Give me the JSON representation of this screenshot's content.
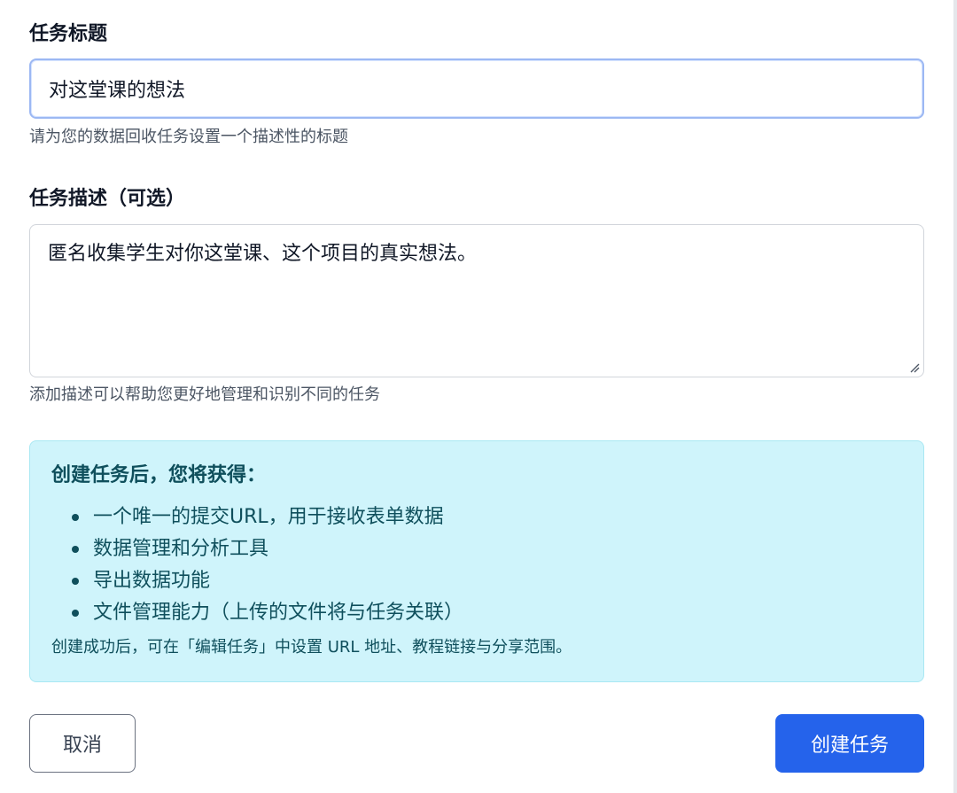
{
  "form": {
    "title_label": "任务标题",
    "title_value": "对这堂课的想法",
    "title_help": "请为您的数据回收任务设置一个描述性的标题",
    "description_label": "任务描述（可选）",
    "description_value": "匿名收集学生对你这堂课、这个项目的真实想法。",
    "description_help": "添加描述可以帮助您更好地管理和识别不同的任务"
  },
  "info": {
    "heading": "创建任务后，您将获得：",
    "items": [
      "一个唯一的提交URL，用于接收表单数据",
      "数据管理和分析工具",
      "导出数据功能",
      "文件管理能力（上传的文件将与任务关联）"
    ],
    "note": "创建成功后，可在「编辑任务」中设置 URL 地址、教程链接与分享范围。"
  },
  "actions": {
    "cancel_label": "取消",
    "create_label": "创建任务"
  },
  "colors": {
    "primary": "#2563eb",
    "info_background": "#cff4fb",
    "info_text": "#0f4f5c",
    "input_focus_border": "#9cb8f3"
  },
  "icons": {
    "resize_handle": "resize-handle-icon",
    "bullet": "bullet-icon"
  }
}
